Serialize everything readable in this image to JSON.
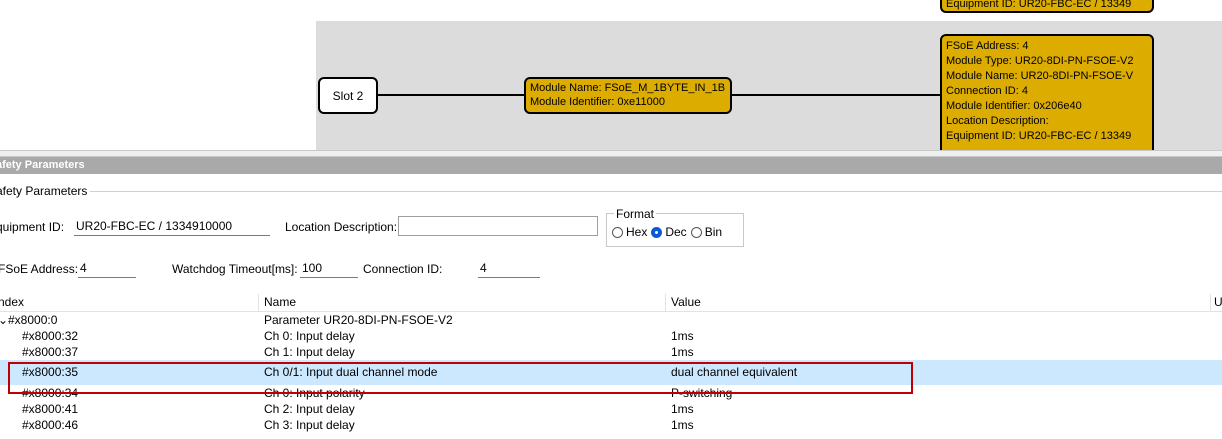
{
  "diagram": {
    "equip_top_text": "Equipment ID:   UR20-FBC-EC / 13349",
    "slot_label": "Slot 2",
    "module": {
      "name_line": "Module Name:   FSoE_M_1BYTE_IN_1B",
      "identifier_line": "Module Identifier:   0xe11000"
    },
    "device": {
      "lines": [
        "FSoE Address:   4",
        "Module Type:   UR20-8DI-PN-FSOE-V2",
        "Module Name:   UR20-8DI-PN-FSOE-V",
        "Connection ID:   4",
        "Module Identifier:   0x206e40",
        "Location Description:",
        "Equipment ID:   UR20-FBC-EC / 13349"
      ]
    }
  },
  "panel": {
    "title": "afety Parameters",
    "group_label": "afety Parameters",
    "equipment_id_label": "quipment ID:",
    "equipment_id_value": "UR20-FBC-EC / 1334910000",
    "location_description_label": "Location Description:",
    "location_description_value": "",
    "format": {
      "title": "Format",
      "options": [
        "Hex",
        "Dec",
        "Bin"
      ],
      "selected": "Dec"
    },
    "fsoe_address_label": "FSoE Address:",
    "fsoe_address_value": "4",
    "watchdog_label": "Watchdog Timeout[ms]:",
    "watchdog_value": "100",
    "connection_id_label": "Connection ID:",
    "connection_id_value": "4"
  },
  "table": {
    "columns": [
      "ndex",
      "Name",
      "Value",
      "U"
    ],
    "rows": [
      {
        "index": "#x8000:0",
        "name": "Parameter UR20-8DI-PN-FSOE-V2",
        "value": "",
        "expanded": true,
        "level": 0
      },
      {
        "index": "#x8000:32",
        "name": "Ch 0: Input delay",
        "value": "1ms",
        "level": 1
      },
      {
        "index": "#x8000:37",
        "name": "Ch 1: Input delay",
        "value": "1ms",
        "level": 1
      },
      {
        "index": "#x8000:35",
        "name": "Ch 0/1: Input dual channel mode",
        "value": "dual channel equivalent",
        "level": 1,
        "selected": true
      },
      {
        "index": "#x8000:34",
        "name": "Ch 0: Input polarity",
        "value": "P-switching",
        "level": 1
      },
      {
        "index": "#x8000:41",
        "name": "Ch 2: Input delay",
        "value": "1ms",
        "level": 1
      },
      {
        "index": "#x8000:46",
        "name": "Ch 3: Input delay",
        "value": "1ms",
        "level": 1
      }
    ]
  },
  "colors": {
    "node_fill": "#dcad00",
    "selection": "#cce8ff",
    "highlight_border": "#c00000",
    "radio_selected": "#0a5ad8"
  }
}
